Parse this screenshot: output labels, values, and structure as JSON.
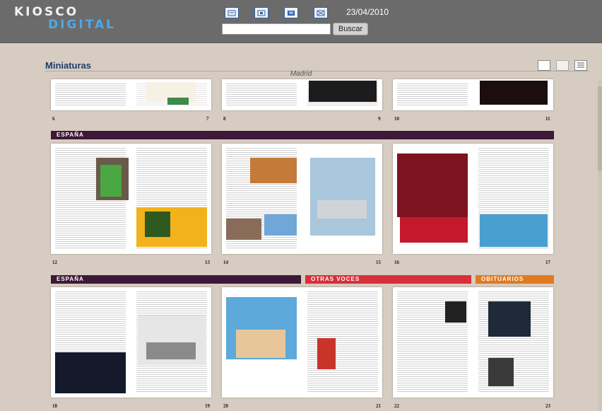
{
  "header": {
    "logo_top": "KIOSCO",
    "logo_bottom": "DIGITAL",
    "date": "23/04/2010",
    "search_button": "Buscar",
    "search_value": "",
    "tool_icons": [
      "page-view-icon",
      "screen-view-icon",
      "list-view-icon",
      "fullscreen-icon"
    ]
  },
  "main": {
    "title": "Miniaturas",
    "city": "Madrid",
    "view_icons": [
      "single-page-view-icon",
      "double-page-view-icon",
      "list-layout-icon"
    ]
  },
  "rows": [
    {
      "sections": [],
      "spreads": [
        {
          "left": "6",
          "right": "7"
        },
        {
          "left": "8",
          "right": "9"
        },
        {
          "left": "10",
          "right": "11"
        }
      ]
    },
    {
      "sections": [
        {
          "label": "ESPAÑA",
          "color": "#3d1838"
        }
      ],
      "spreads": [
        {
          "left": "12",
          "right": "13"
        },
        {
          "left": "14",
          "right": "15"
        },
        {
          "left": "16",
          "right": "17"
        }
      ]
    },
    {
      "sections": [
        {
          "label": "ESPAÑA",
          "color": "#3d1838"
        },
        {
          "label": "OTRAS VOCES",
          "color": "#d7303a"
        },
        {
          "label": "OBITUARIOS",
          "color": "#e07a1f"
        }
      ],
      "spreads": [
        {
          "left": "18",
          "right": "19"
        },
        {
          "left": "20",
          "right": "21"
        },
        {
          "left": "22",
          "right": "23"
        }
      ]
    }
  ]
}
